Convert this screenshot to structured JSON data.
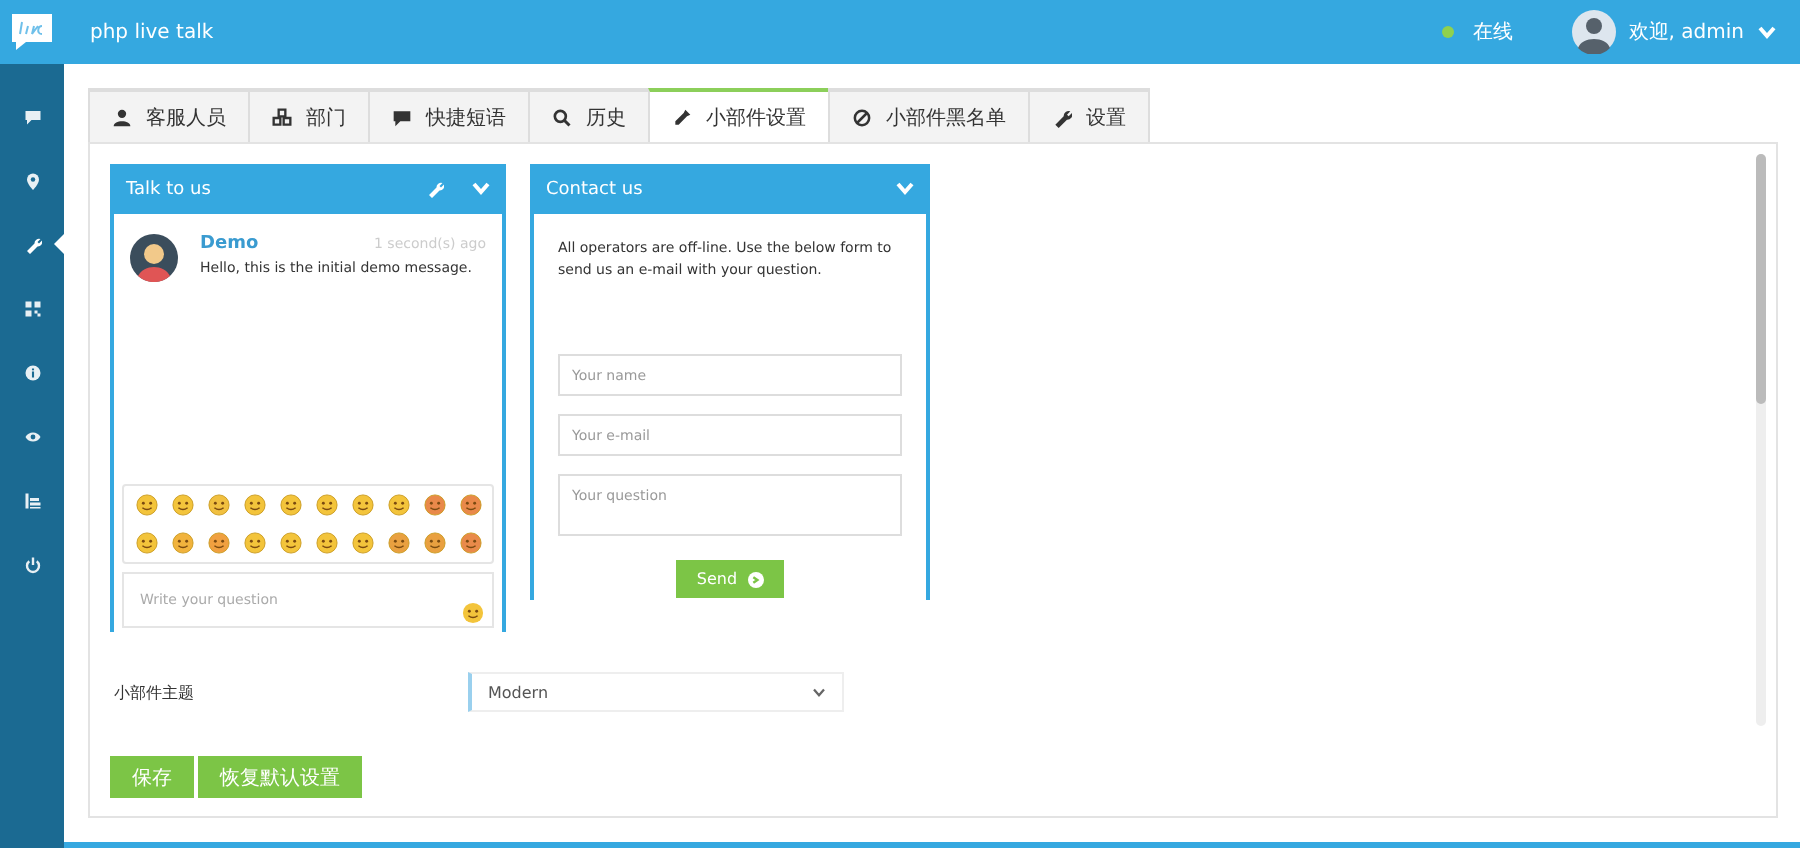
{
  "header": {
    "app_title": "php live talk",
    "status_text": "在线",
    "status_online": true,
    "user_greeting": "欢迎, admin"
  },
  "sidebar": {
    "items": [
      {
        "kind": "chat",
        "selected": false
      },
      {
        "kind": "pin",
        "selected": false
      },
      {
        "kind": "wrench",
        "selected": true
      },
      {
        "kind": "qr",
        "selected": false
      },
      {
        "kind": "info",
        "selected": false
      },
      {
        "kind": "eye",
        "selected": false
      },
      {
        "kind": "report",
        "selected": false
      },
      {
        "kind": "power",
        "selected": false
      }
    ]
  },
  "tabs": [
    {
      "label": "客服人员",
      "kind": "user",
      "selected": false
    },
    {
      "label": "部门",
      "kind": "cubes",
      "selected": false
    },
    {
      "label": "快捷短语",
      "kind": "chat",
      "selected": false
    },
    {
      "label": "历史",
      "kind": "search",
      "selected": false
    },
    {
      "label": "小部件设置",
      "kind": "dropper",
      "selected": true
    },
    {
      "label": "小部件黑名单",
      "kind": "ban",
      "selected": false
    },
    {
      "label": "设置",
      "kind": "wrench",
      "selected": false
    }
  ],
  "chat_widget": {
    "title": "Talk to us",
    "message": {
      "sender": "Demo",
      "time": "1 second(s) ago",
      "text": "Hello, this is the initial demo message."
    },
    "input_placeholder": "Write your question"
  },
  "contact_widget": {
    "title": "Contact us",
    "notice": "All operators are off-line. Use the below form to send us an e-mail with your question.",
    "fields": [
      {
        "placeholder": "Your name",
        "kind": "input"
      },
      {
        "placeholder": "Your e-mail",
        "kind": "input"
      },
      {
        "placeholder": "Your question",
        "kind": "textarea"
      }
    ],
    "send_button": "Send"
  },
  "theme_setting": {
    "label": "小部件主题",
    "value": "Modern"
  },
  "buttons": [
    "保存",
    "恢复默认设置"
  ]
}
